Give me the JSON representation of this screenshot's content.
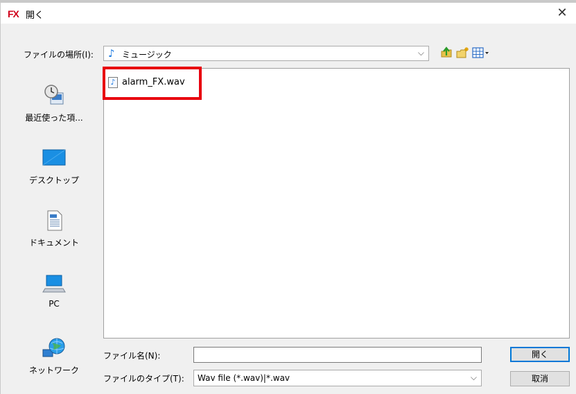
{
  "window": {
    "app_icon_text": "FX",
    "title": "開く",
    "close_glyph": "✕"
  },
  "location": {
    "label": "ファイルの場所(I):",
    "value": "ミュージック",
    "chevron": "⌵"
  },
  "toolbar": {
    "icons": [
      "up-folder-icon",
      "new-folder-icon",
      "view-menu-icon"
    ]
  },
  "places": [
    {
      "label": "最近使った項...",
      "icon": "recent-places-icon"
    },
    {
      "label": "デスクトップ",
      "icon": "desktop-icon"
    },
    {
      "label": "ドキュメント",
      "icon": "documents-icon"
    },
    {
      "label": "PC",
      "icon": "pc-icon"
    },
    {
      "label": "ネットワーク",
      "icon": "network-icon"
    }
  ],
  "files": [
    {
      "name": "alarm_FX.wav",
      "icon": "audio-file-icon"
    }
  ],
  "filename": {
    "label": "ファイル名(N):",
    "value": ""
  },
  "filetype": {
    "label": "ファイルのタイプ(T):",
    "value": "Wav file (*.wav)|*.wav",
    "chevron": "⌵"
  },
  "buttons": {
    "open": "開く",
    "cancel": "取消"
  },
  "colors": {
    "highlight": "#e8000e",
    "accent": "#0078d7",
    "app_icon": "#d0021b"
  }
}
